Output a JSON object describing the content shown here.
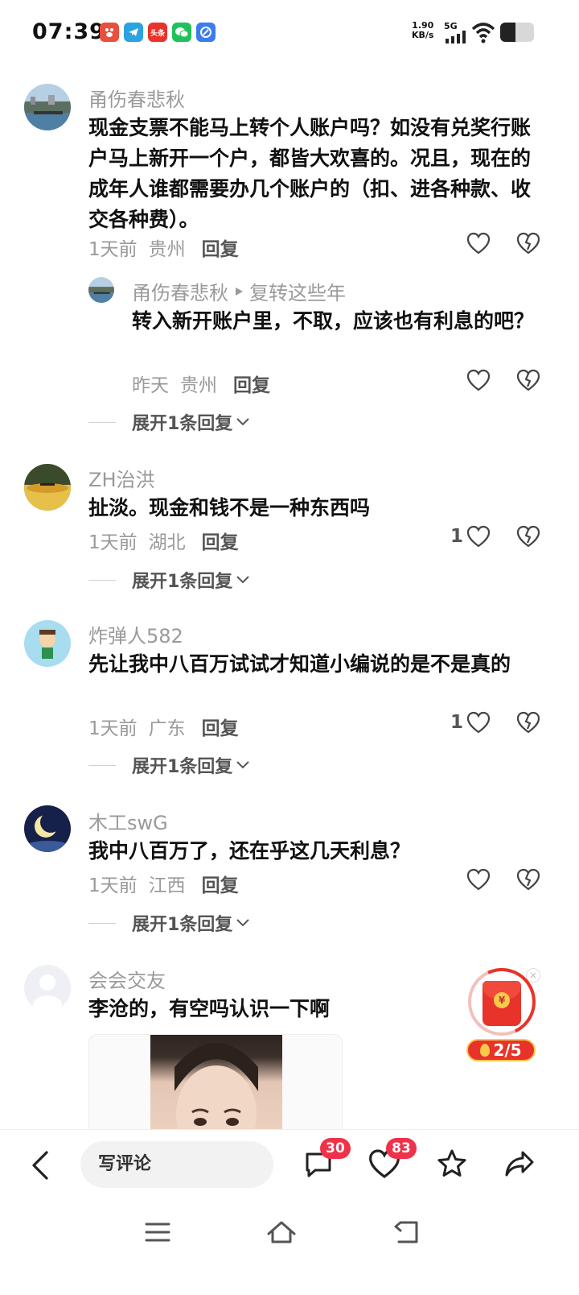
{
  "status_bar": {
    "time": "07:39",
    "net_speed_value": "1.90",
    "net_speed_unit": "KB/s",
    "signal": "5G",
    "battery_percent": 45,
    "app_icons": [
      {
        "name": "baidu-app-icon",
        "color": "#e94f3c",
        "text": ""
      },
      {
        "name": "telegram-app-icon",
        "color": "#2aa3e0",
        "text": ""
      },
      {
        "name": "toutiao-app-icon",
        "color": "#e8332b",
        "text": "头条"
      },
      {
        "name": "wechat-app-icon",
        "color": "#1fc25a",
        "text": ""
      },
      {
        "name": "browser-app-icon",
        "color": "#3b7df0",
        "text": ""
      }
    ]
  },
  "comments": [
    {
      "username": "甬伤春悲秋",
      "content": "现金支票不能马上转个人账户吗？如没有兑奖行账户马上新开一个户，都皆大欢喜的。况且，现在的成年人谁都需要办几个账户的（扣、进各种款、收交各种费）。",
      "time": "1天前",
      "location": "贵州",
      "reply_label": "回复",
      "likes": "",
      "reply": {
        "username": "甬伤春悲秋",
        "reply_to": "复转这些年",
        "content": "转入新开账户里，不取，应该也有利息的吧？",
        "time": "昨天",
        "location": "贵州",
        "reply_label": "回复"
      },
      "expand_label": "展开1条回复"
    },
    {
      "username": "ZH治洪",
      "content": "扯淡。现金和钱不是一种东西吗",
      "time": "1天前",
      "location": "湖北",
      "reply_label": "回复",
      "likes": "1",
      "expand_label": "展开1条回复"
    },
    {
      "username": "炸弹人582",
      "content": "先让我中八百万试试才知道小编说的是不是真的",
      "time": "1天前",
      "location": "广东",
      "reply_label": "回复",
      "likes": "1",
      "expand_label": "展开1条回复"
    },
    {
      "username": "木工swG",
      "content": "我中八百万了，还在乎这几天利息？",
      "time": "1天前",
      "location": "江西",
      "reply_label": "回复",
      "likes": "",
      "expand_label": "展开1条回复"
    },
    {
      "username": "会会交友",
      "content": "李沧的，有空吗认识一下啊"
    }
  ],
  "red_packet": {
    "coin_symbol": "¥",
    "progress": "2/5",
    "close_symbol": "×"
  },
  "bottom_bar": {
    "write_comment_placeholder": "写评论",
    "comment_count": "30",
    "like_count": "83"
  }
}
